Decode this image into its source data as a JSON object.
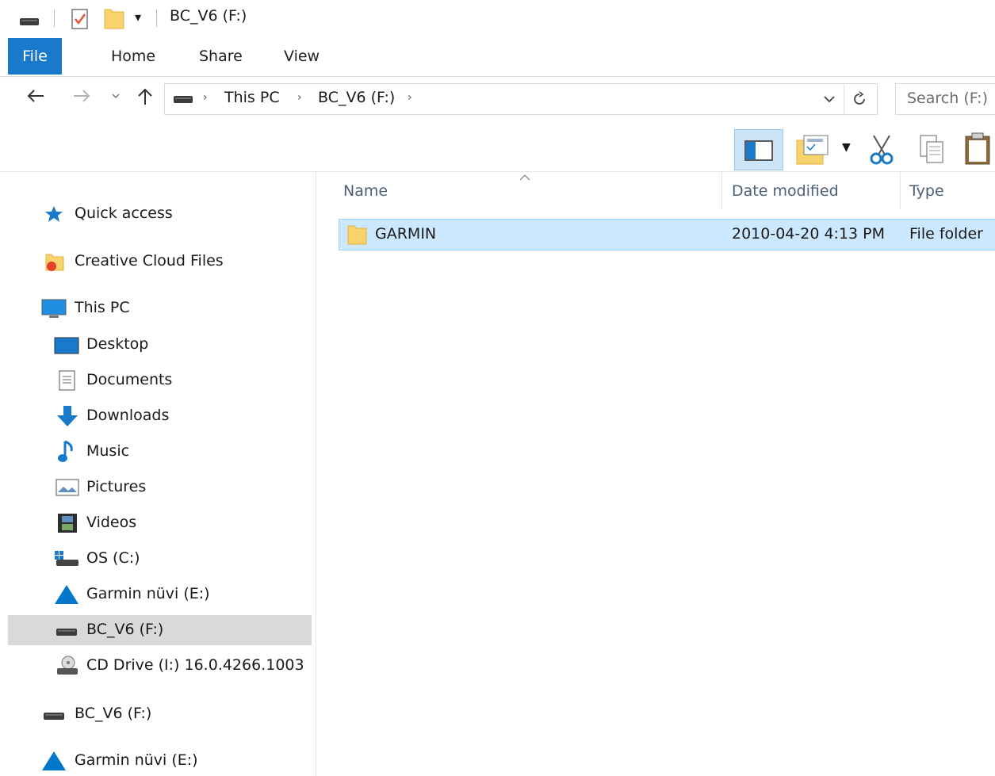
{
  "window": {
    "title": "BC_V6 (F:)"
  },
  "ribbon": {
    "tabs": [
      "File",
      "Home",
      "Share",
      "View"
    ]
  },
  "address": {
    "crumbs": [
      "This PC",
      "BC_V6 (F:)"
    ],
    "search_placeholder": "Search (F:)"
  },
  "columns": {
    "name": "Name",
    "date": "Date modified",
    "type": "Type"
  },
  "files": [
    {
      "name": "GARMIN",
      "date": "2010-04-20 4:13 PM",
      "type": "File folder"
    }
  ],
  "nav": {
    "quick_access": "Quick access",
    "creative_cloud": "Creative Cloud Files",
    "this_pc": "This PC",
    "children": [
      "Desktop",
      "Documents",
      "Downloads",
      "Music",
      "Pictures",
      "Videos",
      "OS (C:)",
      "Garmin nüvi (E:)",
      "BC_V6 (F:)",
      "CD Drive (I:) 16.0.4266.1003"
    ],
    "drive_bc": "BC_V6 (F:)",
    "drive_garmin": "Garmin nüvi (E:)"
  },
  "colors": {
    "accent": "#1979ca",
    "selection": "#cce8ff",
    "selection_border": "#99d1ff",
    "nav_selected": "#d9d9d9"
  }
}
